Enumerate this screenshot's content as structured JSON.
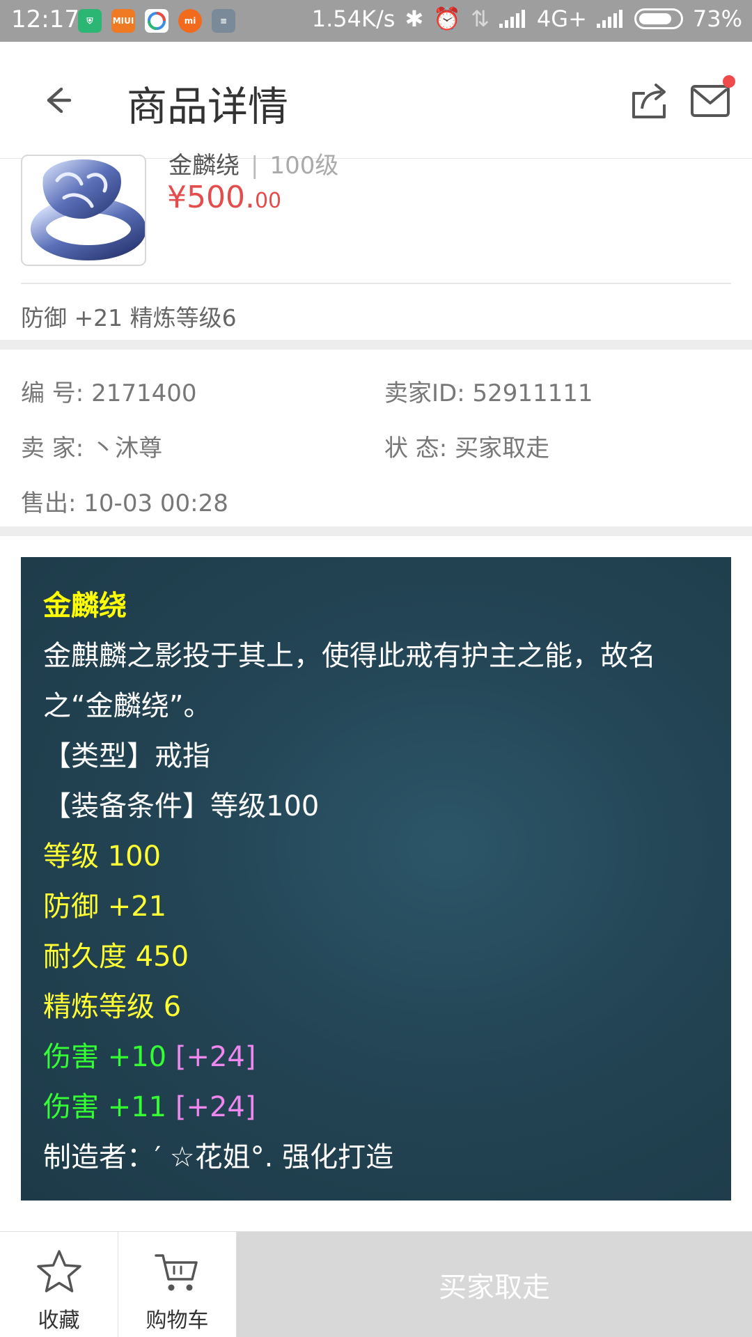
{
  "status_bar": {
    "time": "12:17",
    "speed": "1.54K/s",
    "network": "4G+",
    "battery": "73%"
  },
  "header": {
    "title": "商品详情"
  },
  "product": {
    "name": "金麟绕",
    "level": "100级",
    "price_main": "¥500.",
    "price_cents": "00",
    "attributes": "防御 +21 精炼等级6"
  },
  "info": {
    "id_label": "编  号:",
    "id_value": "2171400",
    "seller_id_label": "卖家ID:",
    "seller_id_value": "52911111",
    "seller_label": "卖  家:",
    "seller_value": "丶沐尊",
    "status_label": "状  态:",
    "status_value": "买家取走",
    "sold_label": "售出:",
    "sold_value": "10-03 00:28"
  },
  "description": {
    "name": "金麟绕",
    "lore_1": "金麒麟之影投于其上，使得此戒有护主之能，故名",
    "lore_2": "之“金麟绕”。",
    "type": "【类型】戒指",
    "requirement": "【装备条件】等级100",
    "level": "等级 100",
    "defense": "防御 +21",
    "durability": "耐久度 450",
    "refine": "精炼等级 6",
    "damage1": "伤害 +10",
    "damage1_bonus": "[+24]",
    "damage2": "伤害 +11",
    "damage2_bonus": "[+24]",
    "maker": "制造者：′  ☆花姐°. 强化打造"
  },
  "bottom_bar": {
    "favorite_label": "收藏",
    "cart_label": "购物车",
    "action_label": "买家取走"
  },
  "colors": {
    "price_red": "#e54d4d",
    "desc_bg": "#234454",
    "yellow": "#ffff33",
    "green": "#33ff33",
    "pink": "#ee88ee",
    "action_bg": "#d8d8d8"
  }
}
